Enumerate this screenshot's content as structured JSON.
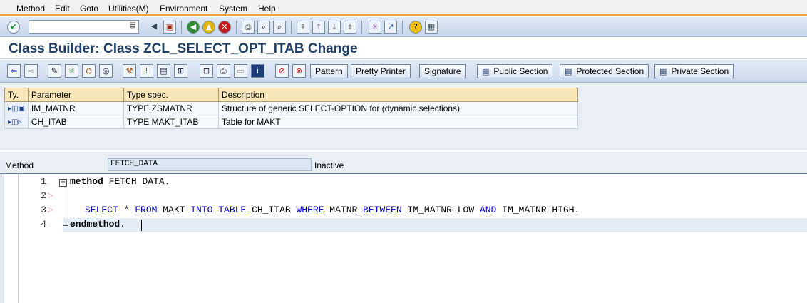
{
  "menu": [
    "Method",
    "Edit",
    "Goto",
    "Utilities(M)",
    "Environment",
    "System",
    "Help"
  ],
  "standard_toolbar": {
    "command_field_value": ""
  },
  "title": "Class Builder: Class ZCL_SELECT_OPT_ITAB Change",
  "app_toolbar": {
    "buttons": [
      "Pattern",
      "Pretty Printer",
      "Signature",
      "Public Section",
      "Protected Section",
      "Private Section"
    ]
  },
  "parameters": {
    "columns": [
      "Ty.",
      "Parameter",
      "Type spec.",
      "Description"
    ],
    "rows": [
      {
        "parameter": "IM_MATNR",
        "type_spec": "TYPE ZSMATNR",
        "description": "Structure of generic SELECT-OPTION for (dynamic selections)"
      },
      {
        "parameter": "CH_ITAB",
        "type_spec": "TYPE MAKT_ITAB",
        "description": "Table for MAKT"
      }
    ]
  },
  "method_strip": {
    "label": "Method",
    "value": "FETCH_DATA",
    "status": "Inactive"
  },
  "editor": {
    "line_numbers": [
      "1",
      "2",
      "3",
      "4"
    ],
    "line1": {
      "kw": "method",
      "rest": " FETCH_DATA."
    },
    "line3": {
      "t1": "SELECT",
      "t2": " * ",
      "t3": "FROM",
      "t4": " MAKT ",
      "t5": "INTO TABLE",
      "t6": " CH_ITAB ",
      "t7": "WHERE",
      "t8": " MATNR ",
      "t9": "BETWEEN",
      "t10": " IM_MATNR-LOW ",
      "t11": "AND",
      "t12": " IM_MATNR-HIGH."
    },
    "line4": {
      "kw": "endmethod",
      "rest": "."
    }
  },
  "icons": {
    "menu_accent": "#e8a33a",
    "title_color": "#1f3f66",
    "keyword_color": "#0000cc"
  }
}
